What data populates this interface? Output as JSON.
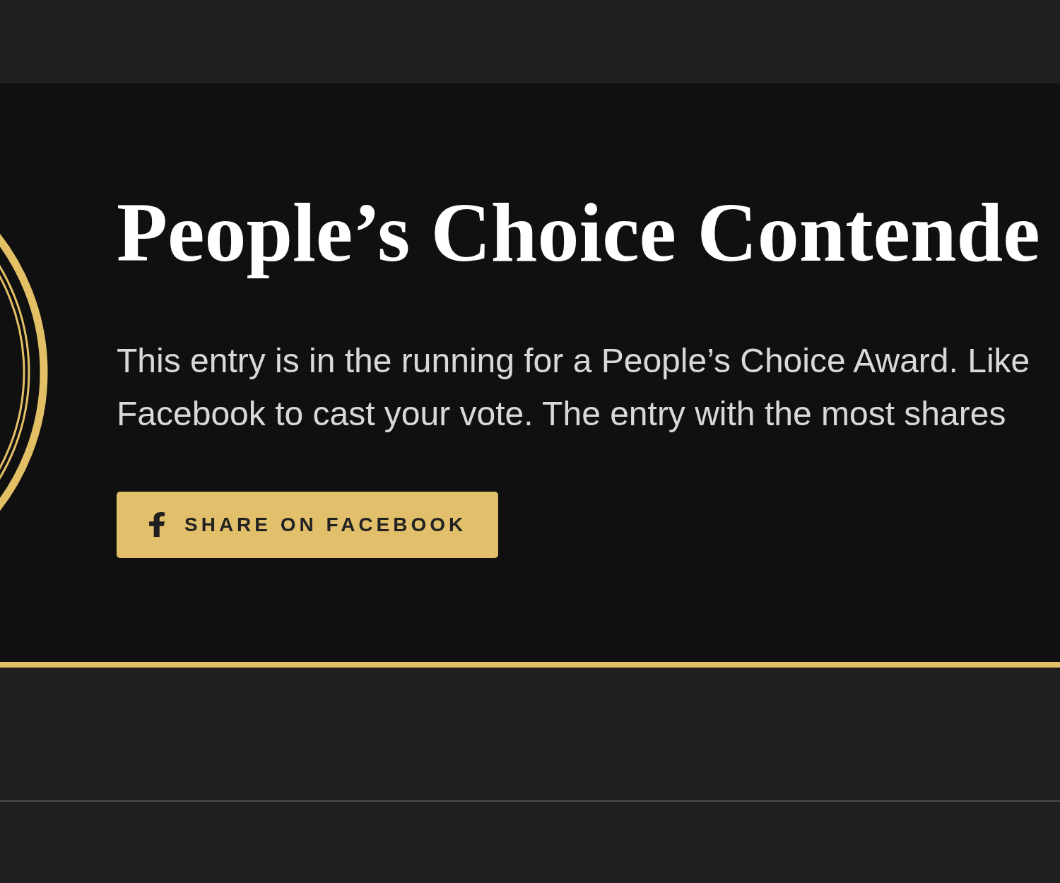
{
  "contender_panel": {
    "title": "People’s Choice Contende",
    "description_lines": [
      "This entry is in the running for a People’s Choice Award. Like",
      "Facebook to cast your vote. The entry with the most shares"
    ],
    "share_button": {
      "label": "SHARE ON FACEBOOK"
    }
  }
}
